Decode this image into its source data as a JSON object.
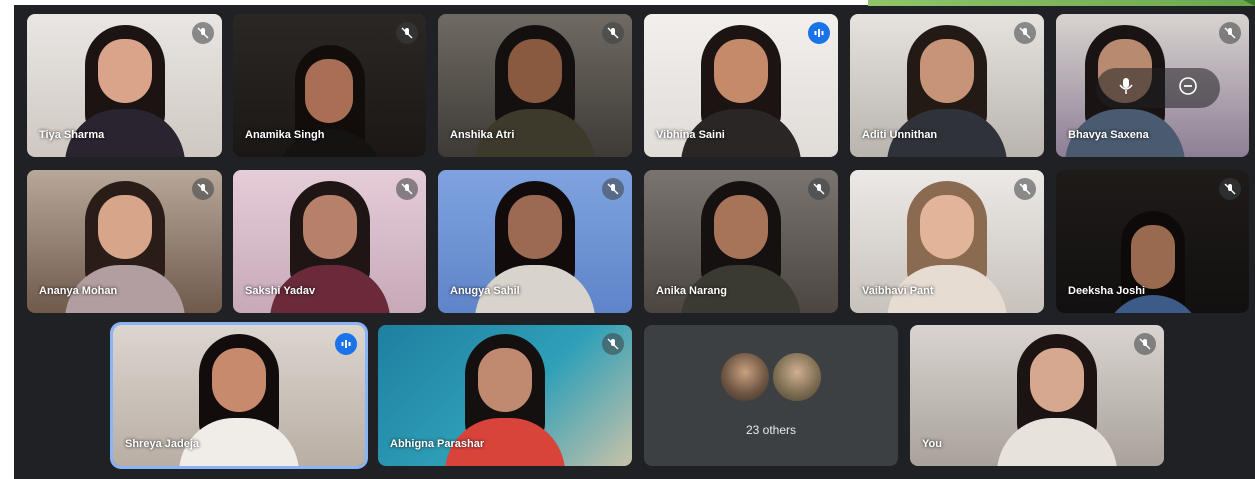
{
  "meeting": {
    "participants": [
      {
        "name": "Tiya Sharma",
        "muted": true
      },
      {
        "name": "Anamika Singh",
        "muted": true
      },
      {
        "name": "Anshika Atri",
        "muted": true
      },
      {
        "name": "Vibhina Saini",
        "muted": false,
        "speaking": true
      },
      {
        "name": "Aditi Unnithan",
        "muted": true
      },
      {
        "name": "Bhavya Saxena",
        "muted": true
      },
      {
        "name": "Ananya Mohan",
        "muted": true
      },
      {
        "name": "Sakshi Yadav",
        "muted": true
      },
      {
        "name": "Anugya Sahil",
        "muted": true
      },
      {
        "name": "Anika Narang",
        "muted": true
      },
      {
        "name": "Vaibhavi Pant",
        "muted": true
      },
      {
        "name": "Deeksha Joshi",
        "muted": true
      },
      {
        "name": "Shreya Jadeja",
        "muted": false,
        "speaking": true
      },
      {
        "name": "Abhigna Parashar",
        "muted": true
      },
      {
        "name": "You",
        "muted": true
      }
    ],
    "others_label": "23 others"
  },
  "colors": {
    "background": "#202124",
    "tile": "#3c4043",
    "speaking_ring": "#8ab4f8",
    "speaking_badge": "#1a73e8"
  },
  "icons": {
    "muted": "mic-off-icon",
    "speaking": "audio-wave-icon",
    "hover_mic": "mic-icon",
    "hover_remove": "remove-circle-icon"
  }
}
